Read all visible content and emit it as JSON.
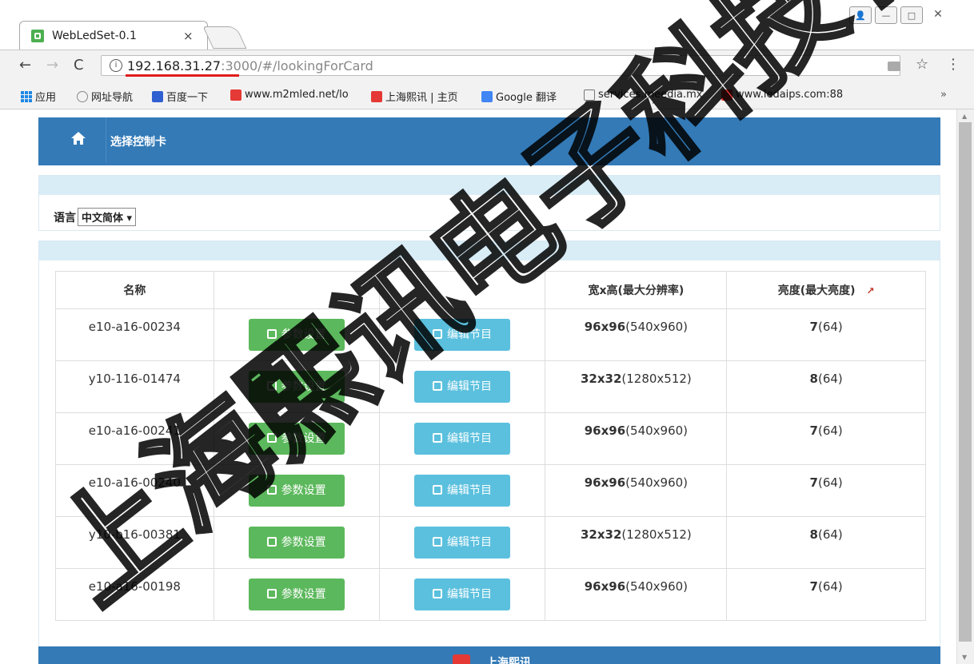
{
  "browser": {
    "tab_title": "WebLedSet-0.1",
    "tab_close": "×",
    "url": {
      "host": "192.168.31.27",
      "rest": ":3000/#/lookingForCard"
    },
    "bookmarks": [
      {
        "label": "应用",
        "icon": "apps-icon"
      },
      {
        "label": "网址导航",
        "icon": "globe-icon"
      },
      {
        "label": "百度一下",
        "icon": "baidu-icon"
      },
      {
        "label": "www.m2mled.net/lo",
        "icon": "red-logo-icon"
      },
      {
        "label": "上海熙讯 | 主页",
        "icon": "red-logo-icon"
      },
      {
        "label": "Google 翻译",
        "icon": "google-translate-icon"
      },
      {
        "label": "services.meedia.mx",
        "icon": "page-icon"
      },
      {
        "label": "www.ledaips.com:88",
        "icon": "red-logo-icon"
      }
    ],
    "bookmarks_more": "»"
  },
  "navbar": {
    "title": "选择控制卡"
  },
  "language": {
    "label": "语言",
    "selected": "中文简体 ▾"
  },
  "table": {
    "headers": [
      "名称",
      "",
      "",
      "宽x高(最大分辨率)",
      "亮度(最大亮度)"
    ],
    "settings_label": "参数设置",
    "edit_label": "编辑节目",
    "rows": [
      {
        "name": "e10-a16-00234",
        "size": "96x96",
        "res": "(540x960)",
        "bright": "7",
        "max": "(64)"
      },
      {
        "name": "y10-116-01474",
        "size": "32x32",
        "res": "(1280x512)",
        "bright": "8",
        "max": "(64)"
      },
      {
        "name": "e10-a16-00241",
        "size": "96x96",
        "res": "(540x960)",
        "bright": "7",
        "max": "(64)"
      },
      {
        "name": "e10-a16-00240",
        "size": "96x96",
        "res": "(540x960)",
        "bright": "7",
        "max": "(64)"
      },
      {
        "name": "y10-b16-00381",
        "size": "32x32",
        "res": "(1280x512)",
        "bright": "8",
        "max": "(64)"
      },
      {
        "name": "e10-a16-00198",
        "size": "96x96",
        "res": "(540x960)",
        "bright": "7",
        "max": "(64)"
      }
    ]
  },
  "footer": {
    "text": "上海熙讯"
  },
  "watermark": {
    "text": "上海熙讯电子科技有限公司"
  },
  "colors": {
    "primary": "#337ab7",
    "success": "#5cb85c",
    "info": "#5bc0de",
    "panel_head": "#d9edf7"
  }
}
